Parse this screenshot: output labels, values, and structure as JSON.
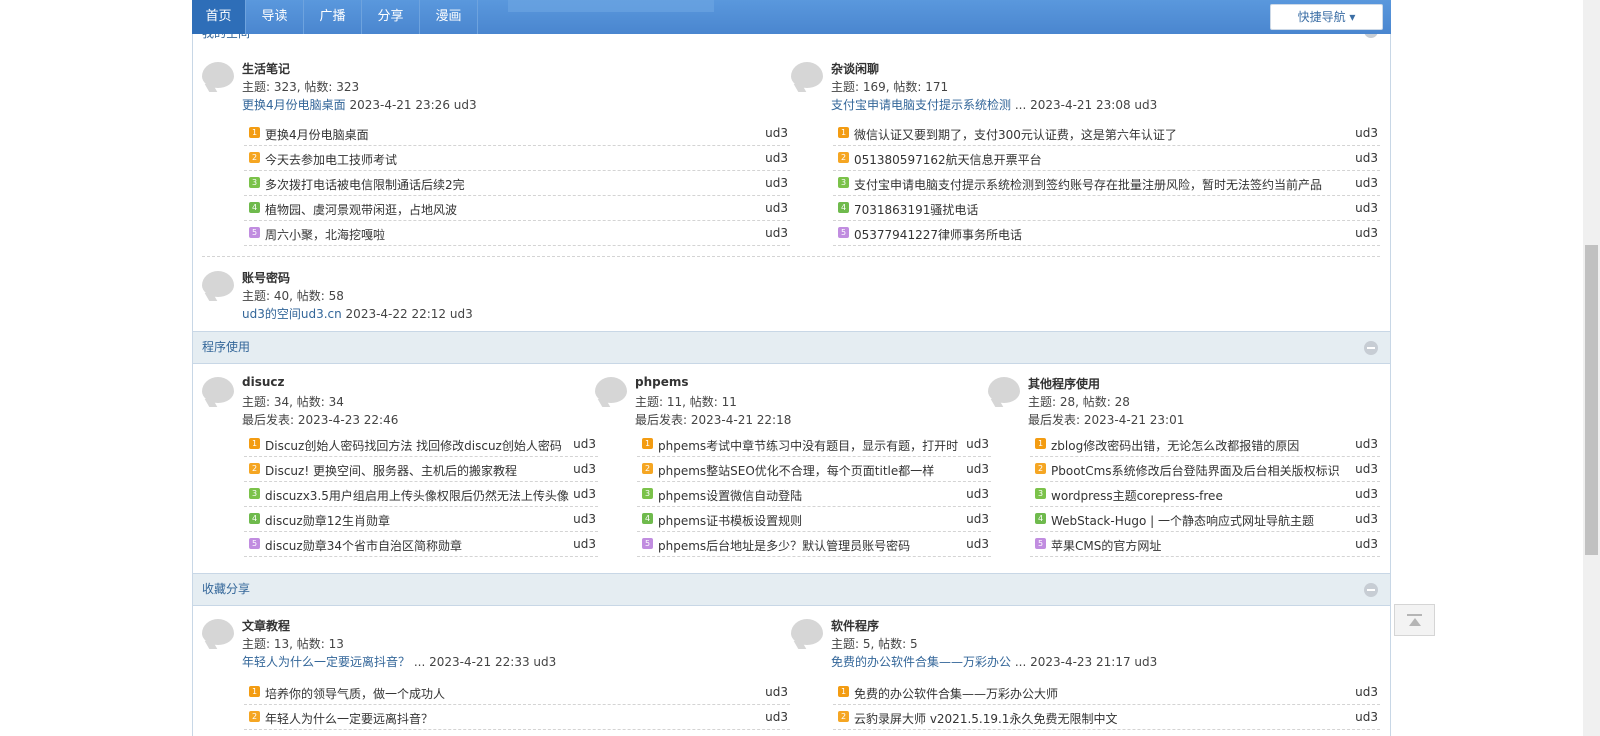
{
  "nav": {
    "tabs": [
      "首页",
      "导读",
      "广播",
      "分享",
      "漫画"
    ],
    "quick_nav": "快捷导航"
  },
  "sections": {
    "my_space": {
      "title": "我的空间"
    },
    "programs": {
      "title": "程序使用"
    },
    "share": {
      "title": "收藏分享"
    }
  },
  "forums": {
    "life": {
      "name": "生活笔记",
      "stats": "主题: 323, 帖数: 323",
      "last_link": "更换4月份电脑桌面",
      "last_meta": " 2023-4-21 23:26 ud3",
      "threads": [
        {
          "title": "更换4月份电脑桌面",
          "author": "ud3"
        },
        {
          "title": "今天去参加电工技师考试",
          "author": "ud3"
        },
        {
          "title": "多次拨打电话被电信限制通话后续2完",
          "author": "ud3"
        },
        {
          "title": "植物园、虞河景观带闲逛，占地风波",
          "author": "ud3"
        },
        {
          "title": "周六小聚，北海挖嘎啦",
          "author": "ud3"
        }
      ]
    },
    "chat": {
      "name": "杂谈闲聊",
      "stats": "主题: 169, 帖数: 171",
      "last_link": "支付宝申请电脑支付提示系统检测",
      "last_meta": " ... 2023-4-21 23:08 ud3",
      "threads": [
        {
          "title": "微信认证又要到期了，支付300元认证费，这是第六年认证了",
          "author": "ud3"
        },
        {
          "title": "051380597162航天信息开票平台",
          "author": "ud3"
        },
        {
          "title": "支付宝申请电脑支付提示系统检测到签约账号存在批量注册风险，暂时无法签约当前产品",
          "author": "ud3"
        },
        {
          "title": "7031863191骚扰电话",
          "author": "ud3"
        },
        {
          "title": "05377941227律师事务所电话",
          "author": "ud3"
        }
      ]
    },
    "account": {
      "name": "账号密码",
      "stats": "主题: 40, 帖数: 58",
      "last_link": "ud3的空间ud3.cn",
      "last_meta": " 2023-4-22 22:12 ud3"
    },
    "discuz": {
      "name": "disucz",
      "stats": "主题: 34, 帖数: 34",
      "last": "最后发表: 2023-4-23 22:46",
      "threads": [
        {
          "title": "Discuz创始人密码找回方法 找回修改discuz创始人密码",
          "author": "ud3"
        },
        {
          "title": "Discuz! 更换空间、服务器、主机后的搬家教程",
          "author": "ud3"
        },
        {
          "title": "discuzx3.5用户组启用上传头像权限后仍然无法上传头像",
          "author": "ud3"
        },
        {
          "title": "discuz勋章12生肖勋章",
          "author": "ud3"
        },
        {
          "title": "discuz勋章34个省市自治区简称勋章",
          "author": "ud3"
        }
      ]
    },
    "phpems": {
      "name": "phpems",
      "stats": "主题: 11, 帖数: 11",
      "last": "最后发表: 2023-4-21 22:18",
      "threads": [
        {
          "title": "phpems考试中章节练习中没有题目，显示有题，打开时",
          "author": "ud3"
        },
        {
          "title": "phpems整站SEO优化不合理，每个页面title都一样",
          "author": "ud3"
        },
        {
          "title": "phpems设置微信自动登陆",
          "author": "ud3"
        },
        {
          "title": "phpems证书模板设置规则",
          "author": "ud3"
        },
        {
          "title": "phpems后台地址是多少？默认管理员账号密码",
          "author": "ud3"
        }
      ]
    },
    "other": {
      "name": "其他程序使用",
      "stats": "主题: 28, 帖数: 28",
      "last": "最后发表: 2023-4-21 23:01",
      "threads": [
        {
          "title": "zblog修改密码出错，无论怎么改都报错的原因",
          "author": "ud3"
        },
        {
          "title": "PbootCms系统修改后台登陆界面及后台相关版权标识",
          "author": "ud3"
        },
        {
          "title": "wordpress主题corepress-free",
          "author": "ud3"
        },
        {
          "title": "WebStack-Hugo | 一个静态响应式网址导航主题",
          "author": "ud3"
        },
        {
          "title": "苹果CMS的官方网址",
          "author": "ud3"
        }
      ]
    },
    "articles": {
      "name": "文章教程",
      "stats": "主题: 13, 帖数: 13",
      "last_link": "年轻人为什么一定要远离抖音？",
      "last_meta": " ... 2023-4-21 22:33 ud3",
      "threads": [
        {
          "title": "培养你的领导气质，做一个成功人",
          "author": "ud3"
        },
        {
          "title": "年轻人为什么一定要远离抖音？",
          "author": "ud3"
        }
      ]
    },
    "software": {
      "name": "软件程序",
      "stats": "主题: 5, 帖数: 5",
      "last_link": "免费的办公软件合集——万彩办公",
      "last_meta": " ... 2023-4-23 21:17 ud3",
      "threads": [
        {
          "title": "免费的办公软件合集——万彩办公大师",
          "author": "ud3"
        },
        {
          "title": "云豹录屏大师 v2021.5.19.1永久免费无限制中文",
          "author": "ud3"
        }
      ]
    }
  },
  "thread_icons": [
    "1",
    "2",
    "3",
    "4",
    "5"
  ]
}
